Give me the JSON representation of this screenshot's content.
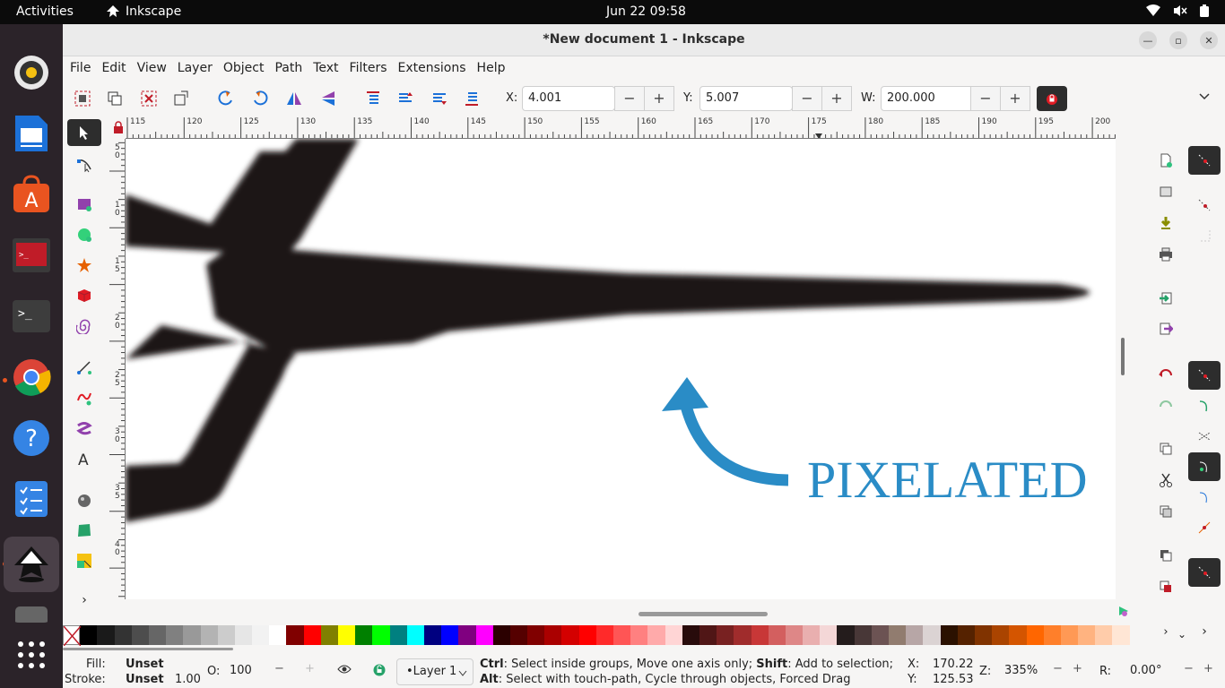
{
  "topbar": {
    "activities": "Activities",
    "app_name": "Inkscape",
    "clock": "Jun 22  09:58"
  },
  "window": {
    "title": "*New document 1 - Inkscape"
  },
  "menus": [
    "File",
    "Edit",
    "View",
    "Layer",
    "Object",
    "Path",
    "Text",
    "Filters",
    "Extensions",
    "Help"
  ],
  "toolbar": {
    "x_label": "X:",
    "x_value": "4.001",
    "y_label": "Y:",
    "y_value": "5.007",
    "w_label": "W:",
    "w_value": "200.000",
    "minus": "−",
    "plus": "+"
  },
  "ruler": {
    "h_labels": [
      "115",
      "120",
      "125",
      "130",
      "135",
      "140",
      "145",
      "150",
      "155",
      "160",
      "165",
      "170",
      "175",
      "180",
      "185",
      "190",
      "195",
      "200"
    ],
    "v_labels": [
      "5\n0",
      "1\n0",
      "1\n5",
      "2\n0",
      "2\n5",
      "3\n0",
      "3\n5",
      "4\n0"
    ]
  },
  "canvas": {
    "annotation_text": "PIXELATED"
  },
  "colors": {
    "accent": "#2a8cc6",
    "dock_bg": "#2b2329",
    "topbar_bg": "#0b0b0b",
    "ubuntu_orange": "#e95420"
  },
  "palette": [
    "#000000",
    "#1a1a1a",
    "#333333",
    "#4d4d4d",
    "#666666",
    "#808080",
    "#999999",
    "#b3b3b3",
    "#cccccc",
    "#e6e6e6",
    "#f2f2f2",
    "#ffffff",
    "#800000",
    "#ff0000",
    "#808000",
    "#ffff00",
    "#008000",
    "#00ff00",
    "#008080",
    "#00ffff",
    "#000080",
    "#0000ff",
    "#800080",
    "#ff00ff",
    "#2b0000",
    "#550000",
    "#800000",
    "#aa0000",
    "#d40000",
    "#ff0000",
    "#ff2a2a",
    "#ff5555",
    "#ff8080",
    "#ffaaaa",
    "#ffd5d5",
    "#280b0b",
    "#501616",
    "#782121",
    "#a02c2c",
    "#c83737",
    "#d35f5f",
    "#de8787",
    "#e9afaf",
    "#f4d7d7",
    "#241c1c",
    "#483737",
    "#6c5353",
    "#917c6f",
    "#b7a6a6",
    "#dbd3d3",
    "#2b1100",
    "#552200",
    "#803300",
    "#aa4400",
    "#d45500",
    "#ff6600",
    "#ff7f2a",
    "#ff9955",
    "#ffb380",
    "#ffccaa",
    "#ffe6d5"
  ],
  "status": {
    "fill_label": "Fill:",
    "fill_value": "Unset",
    "stroke_label": "Stroke:",
    "stroke_value": "Unset",
    "stroke_width": "1.00",
    "opacity_label": "O:",
    "opacity_value": "100",
    "layer": "•Layer 1",
    "msg1_key1": "Ctrl",
    "msg1_text1": ": Select inside groups, Move one axis only; ",
    "msg1_key2": "Shift",
    "msg1_text2": ": Add to selection;",
    "msg2_key1": "Alt",
    "msg2_text1": ": Select with touch-path, Cycle through objects, Forced Drag",
    "cursor_x_label": "X:",
    "cursor_x": "170.22",
    "cursor_y_label": "Y:",
    "cursor_y": "125.53",
    "zoom_label": "Z:",
    "zoom": "335%",
    "rotate_label": "R:",
    "rotate": "0.00°"
  }
}
